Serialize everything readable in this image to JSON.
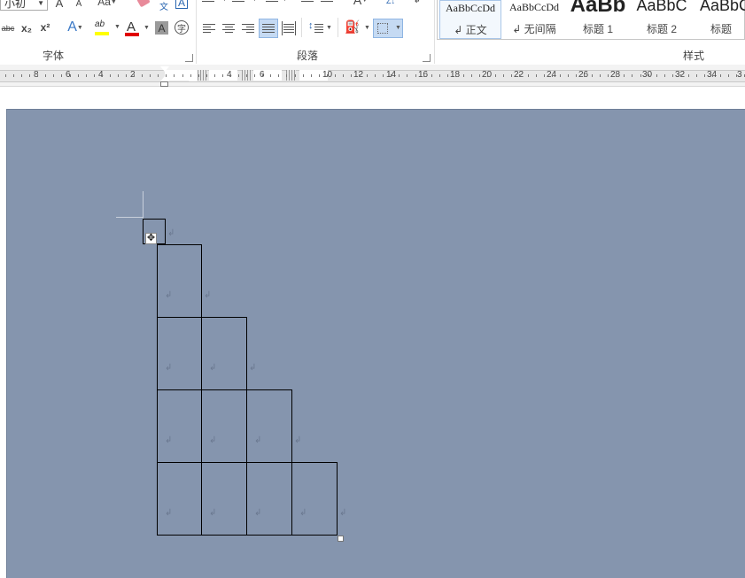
{
  "ribbon": {
    "font_group": {
      "label": "字体",
      "font_size_value": "小初",
      "grow_font": "A",
      "shrink_font": "A",
      "change_case": "Aa",
      "strikethrough": "abc",
      "subscript": "x₂",
      "superscript": "x²",
      "text_effect": "A",
      "highlight": "ab",
      "font_color": "A",
      "char_shading": "A",
      "enclose_char": "字",
      "phonetic_guide": "文",
      "char_border": "A"
    },
    "paragraph_group": {
      "label": "段落",
      "sort": "Z↓"
    },
    "styles_group": {
      "label": "样式",
      "items": [
        {
          "sample": "AaBbCcDd",
          "name": "↲ 正文"
        },
        {
          "sample": "AaBbCcDd",
          "name": "↲ 无间隔"
        },
        {
          "sample": "AaBb",
          "name": "标题 1"
        },
        {
          "sample": "AaBbC",
          "name": "标题 2"
        },
        {
          "sample": "AaBbC",
          "name": "标题"
        }
      ]
    }
  },
  "ruler": {
    "left_numbers": [
      "8",
      "6",
      "4",
      "2"
    ],
    "mid_numbers": [
      "4",
      "6"
    ],
    "right_numbers": [
      "10",
      "12",
      "14",
      "16",
      "18",
      "20",
      "22",
      "24",
      "26",
      "28",
      "30",
      "32",
      "34",
      "3"
    ]
  },
  "document": {
    "paragraph_mark": "↲",
    "move_handle_glyph": "✥"
  }
}
